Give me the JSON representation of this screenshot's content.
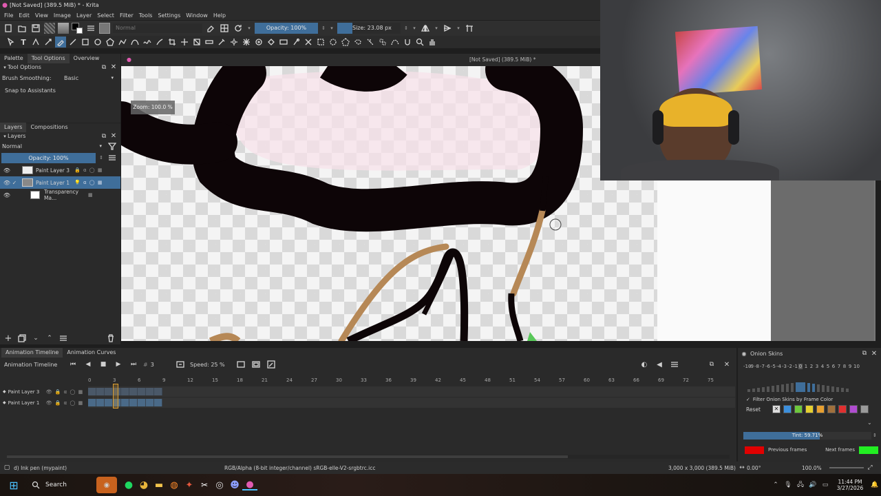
{
  "window": {
    "title": "[Not Saved]  (389.5 MiB) * - Krita"
  },
  "menu": [
    "File",
    "Edit",
    "View",
    "Image",
    "Layer",
    "Select",
    "Filter",
    "Tools",
    "Settings",
    "Window",
    "Help"
  ],
  "toolbar": {
    "blend_mode": "Normal",
    "opacity_label": "Opacity: 100%",
    "size_label": "Size: 23.08 px"
  },
  "dockers_top": {
    "tabs": [
      "Palette",
      "Tool Options",
      "Overview"
    ],
    "tool_options_title": "Tool Options",
    "brush_smoothing_label": "Brush Smoothing:",
    "brush_smoothing_value": "Basic",
    "snap_label": "Snap to Assistants"
  },
  "canvas": {
    "doc_title": "[Not Saved]  (389.5 MiB) *",
    "zoom_overlay": "Zoom: 100.0 %"
  },
  "layers": {
    "tabs": [
      "Layers",
      "Compositions"
    ],
    "title": "Layers",
    "blend_mode": "Normal",
    "opacity": "Opacity:  100%",
    "items": [
      {
        "name": "Paint Layer 3",
        "selected": false
      },
      {
        "name": "Paint Layer 1",
        "selected": true
      },
      {
        "name": "Transparency Ma...",
        "selected": false
      }
    ]
  },
  "timeline": {
    "tabs": [
      "Animation Timeline",
      "Animation Curves"
    ],
    "title": "Animation Timeline",
    "frame": "3",
    "speed": "Speed: 25 %",
    "ticks": [
      "0",
      "3",
      "6",
      "9",
      "12",
      "15",
      "18",
      "21",
      "24",
      "27",
      "30",
      "33",
      "36",
      "39",
      "42",
      "45",
      "48",
      "51",
      "54",
      "57",
      "60",
      "63",
      "66",
      "69",
      "72",
      "75"
    ],
    "layers": [
      "Paint Layer 3",
      "Paint Layer 1"
    ]
  },
  "onion": {
    "title": "Onion Skins",
    "numbers": [
      "-10",
      "-9",
      "-8",
      "-7",
      "-6",
      "-5",
      "-4",
      "-3",
      "-2",
      "-1",
      "0",
      "1",
      "2",
      "3",
      "4",
      "5",
      "6",
      "7",
      "8",
      "9",
      "10"
    ],
    "filter_label": "Filter Onion Skins by Frame Color",
    "reset_label": "Reset",
    "tint_label": "Tint: 59.71%",
    "tint_fraction": 0.5971,
    "previous_label": "Previous frames",
    "next_label": "Next frames",
    "previous_color": "#e00000",
    "next_color": "#22ee22",
    "swatch_colors": [
      "#3c8fdc",
      "#6dc83c",
      "#e6d030",
      "#e8a030",
      "#a0703c",
      "#e03030",
      "#b04cd0",
      "#9a9a9a"
    ]
  },
  "statusbar": {
    "brush": "d) Ink pen (mypaint)",
    "color_space": "RGB/Alpha (8-bit integer/channel)  sRGB-elle-V2-srgbtrc.icc",
    "dimensions": "3,000 x 3,000 (389.5 MiB)",
    "rotation": "0.00°",
    "zoom": "100.0%"
  },
  "taskbar": {
    "search_label": "Search",
    "time": "11:44 PM",
    "date": "3/27/2026"
  }
}
